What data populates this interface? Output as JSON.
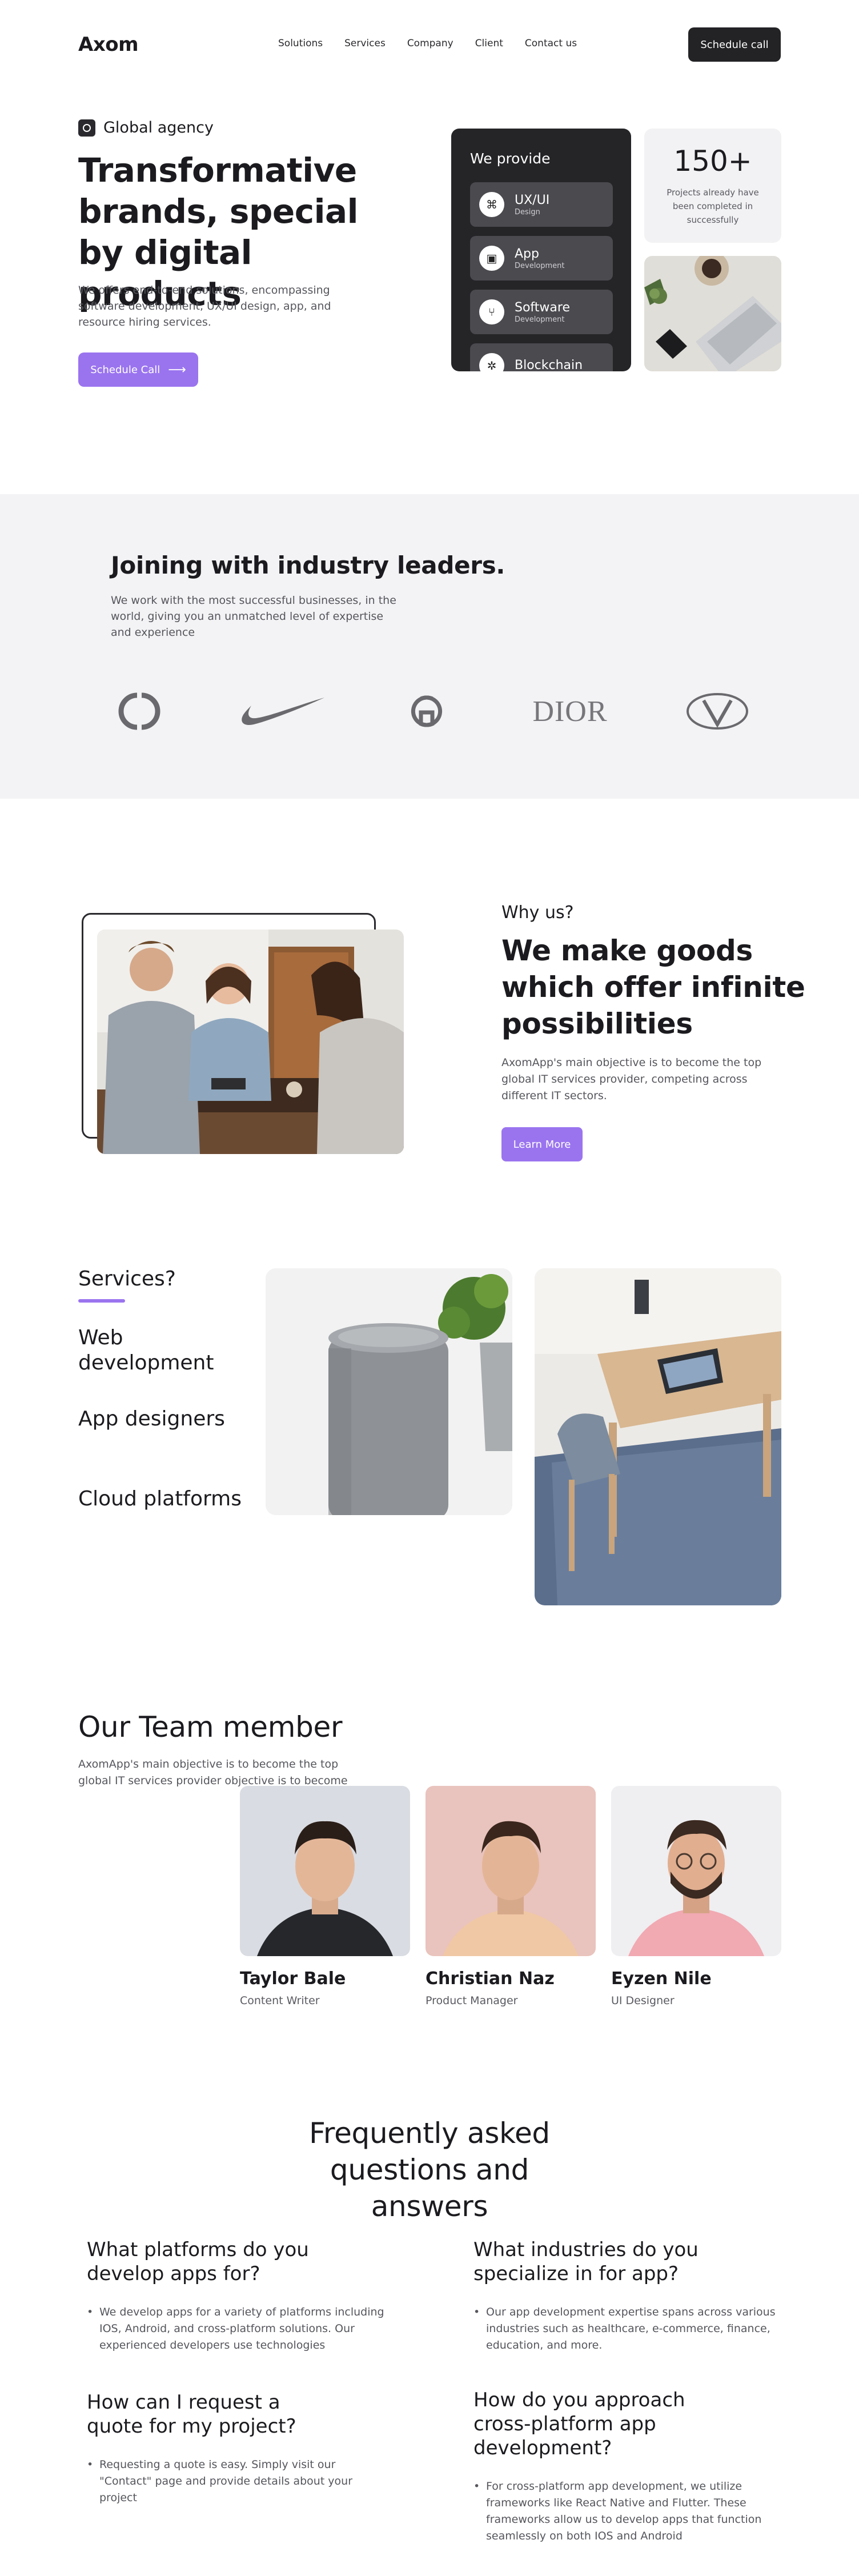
{
  "nav": {
    "logo": "Axom",
    "links": [
      "Solutions",
      "Services",
      "Company",
      "Client",
      "Contact us"
    ],
    "cta": "Schedule call"
  },
  "hero": {
    "tag": "Global agency",
    "title": "Transformative brands, special by digital products",
    "description": "We offers end-to-end solutions, encompassing software development, UX/UI design, app, and resource hiring services.",
    "cta": "Schedule Call"
  },
  "provide": {
    "title": "We provide",
    "items": [
      {
        "main": "UX/UI",
        "sub": "Design",
        "icon": "command-icon"
      },
      {
        "main": "App",
        "sub": "Development",
        "icon": "app-icon"
      },
      {
        "main": "Software",
        "sub": "Development",
        "icon": "git-icon"
      },
      {
        "main": "Blockchain",
        "sub": "",
        "icon": "blockchain-icon"
      }
    ]
  },
  "stats": {
    "value": "150+",
    "description": "Projects already have been completed in successfully"
  },
  "partners": {
    "title": "Joining  with industry leaders.",
    "description": "We work with the most successful businesses, in the world, giving you an unmatched level of expertise and experience",
    "brands": [
      "chanel-logo",
      "nike-logo",
      "gucci-logo",
      "DIOR",
      "valentino-logo"
    ]
  },
  "why": {
    "label": "Why us?",
    "title": "We make goods which offer infinite possibilities",
    "description": "AxomApp's main objective is to become the top global IT services provider, competing across different IT sectors.",
    "cta": "Learn More"
  },
  "services": {
    "label": "Services?",
    "items": [
      "Web development",
      "App designers",
      "Cloud platforms"
    ]
  },
  "team": {
    "title": "Our Team member",
    "description": "AxomApp's main objective is to become the top global IT services provider objective is to become",
    "members": [
      {
        "name": "Taylor Bale",
        "role": "Content Writer"
      },
      {
        "name": "Christian Naz",
        "role": "Product Manager"
      },
      {
        "name": "Eyzen Nile",
        "role": "UI Designer"
      }
    ]
  },
  "faq": {
    "title": "Frequently asked questions and answers",
    "items": [
      {
        "q": "What platforms do you develop apps for?",
        "a": "We develop apps for a variety of platforms including IOS, Android, and cross-platform solutions. Our experienced developers use technologies"
      },
      {
        "q": "What industries do you specialize in for app?",
        "a": "Our app development expertise spans across various industries such as healthcare, e-commerce, finance, education, and more."
      },
      {
        "q": "How can I request a quote for my project?",
        "a": "Requesting a quote is easy. Simply visit our \"Contact\" page and provide details about your project"
      },
      {
        "q": "How do you approach cross-platform app development?",
        "a": "For cross-platform app development, we utilize frameworks like React Native and Flutter. These frameworks allow us to develop apps that function seamlessly on both IOS and Android"
      }
    ]
  },
  "colors": {
    "accent": "#9a74ef",
    "dark": "#232326",
    "muted_bg": "#f3f3f5"
  }
}
